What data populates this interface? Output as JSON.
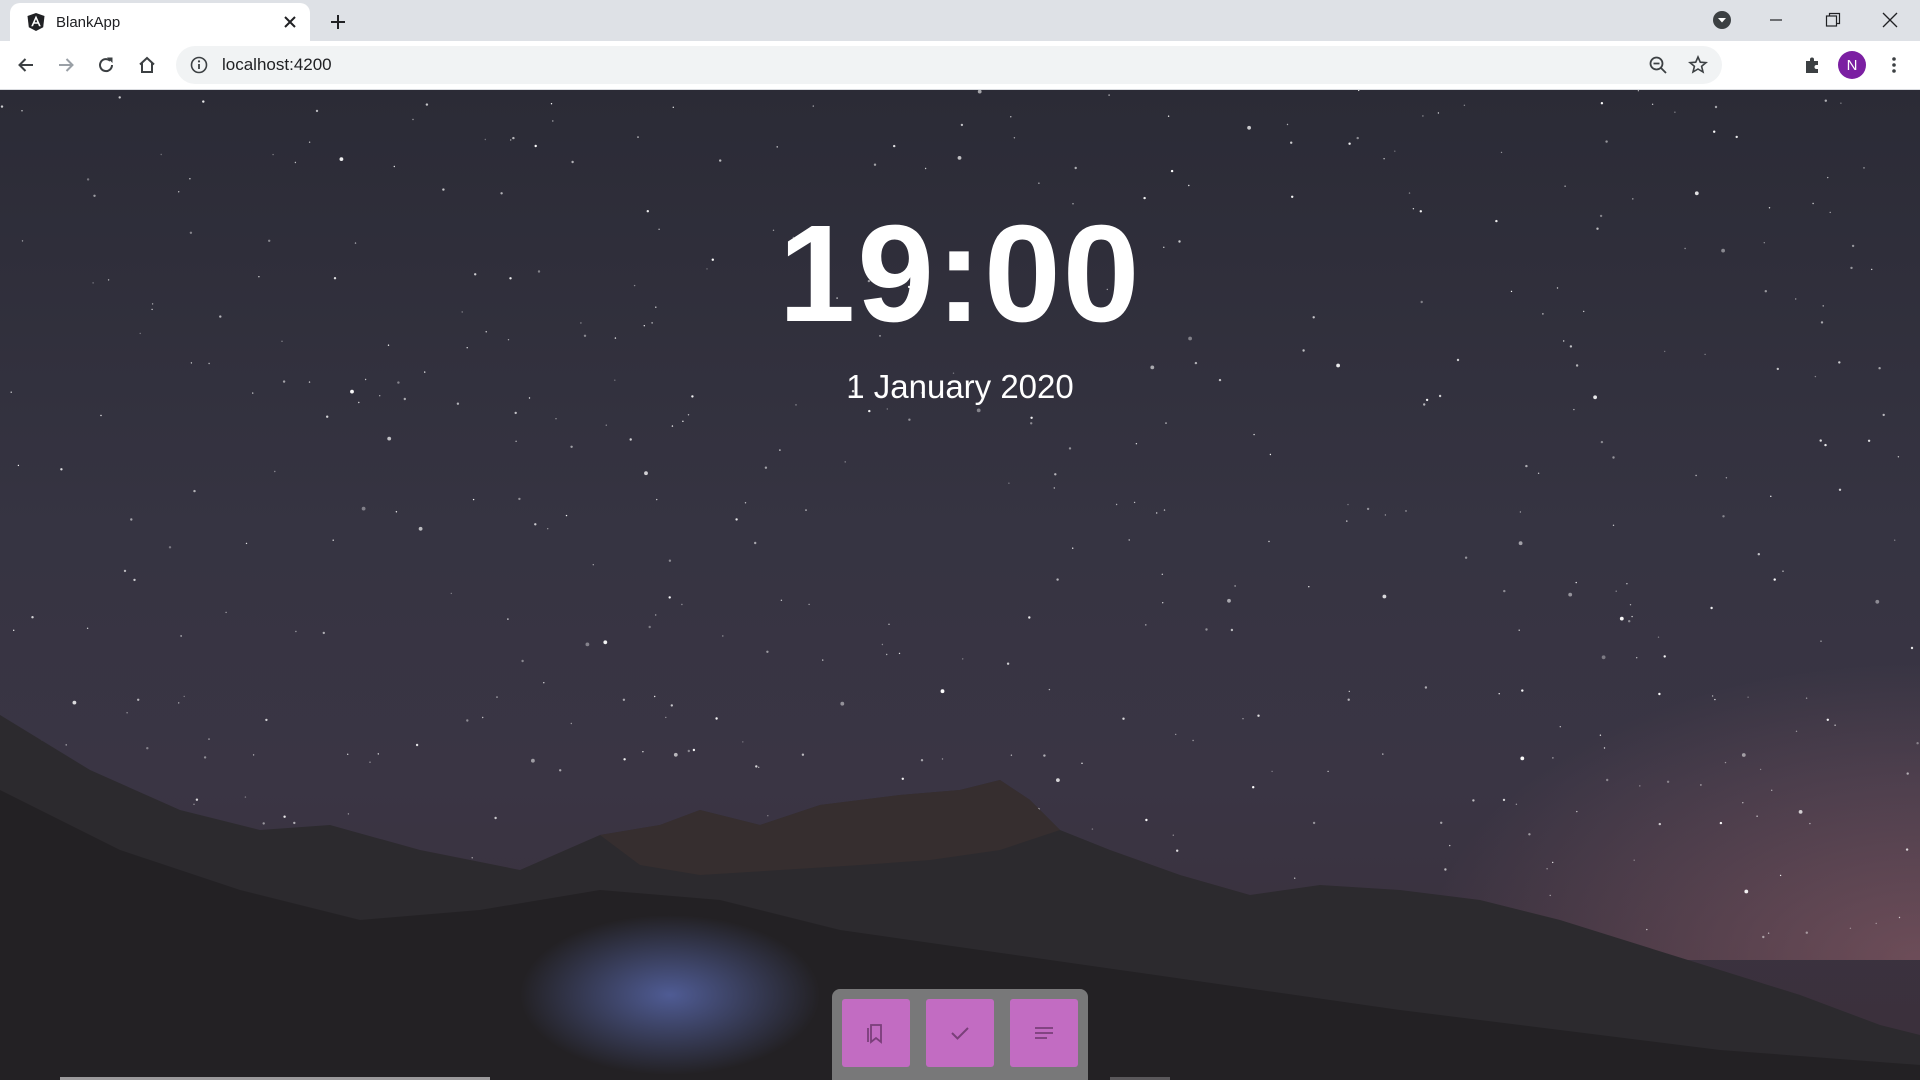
{
  "browser": {
    "tab": {
      "title": "BlankApp",
      "favicon": "angular-icon"
    },
    "address": {
      "url": "localhost:4200"
    },
    "profile_initial": "N",
    "colors": {
      "profile": "#7b1fa2",
      "tabstrip": "#dee1e6"
    }
  },
  "page": {
    "clock": {
      "time": "19:00"
    },
    "date": "1 January 2020",
    "dock": {
      "buttons": [
        {
          "icon": "bookmarks-icon"
        },
        {
          "icon": "check-icon"
        },
        {
          "icon": "notes-icon"
        }
      ],
      "colors": {
        "button": "#c26cc2"
      }
    }
  }
}
